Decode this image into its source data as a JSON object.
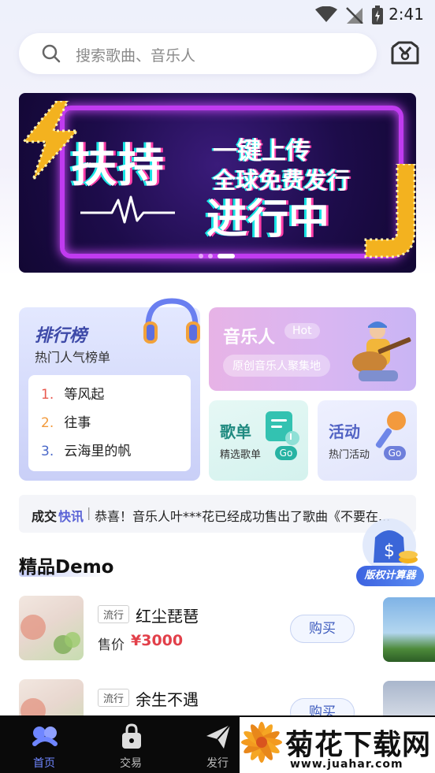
{
  "status_bar": {
    "time": "2:41"
  },
  "search": {
    "placeholder": "搜索歌曲、音乐人"
  },
  "banner": {
    "main_text": "扶持",
    "line1": "一键上传",
    "line2": "全球免费发行",
    "big_text": "进行中",
    "page_count": 3,
    "active_page": 3
  },
  "ranking": {
    "title": "排行榜",
    "subtitle": "热门人气榜单",
    "items": [
      {
        "rank": "1.",
        "name": "等风起",
        "color": "#e85a4f"
      },
      {
        "rank": "2.",
        "name": "往事",
        "color": "#f29a3c"
      },
      {
        "rank": "3.",
        "name": "云海里的帆",
        "color": "#4a68c9"
      }
    ]
  },
  "musician": {
    "title": "音乐人",
    "badge": "Hot",
    "subtitle": "原创音乐人聚集地"
  },
  "playlist": {
    "title": "歌单",
    "subtitle": "精选歌单",
    "go": "Go"
  },
  "activity": {
    "title": "活动",
    "subtitle": "热门活动",
    "go": "Go"
  },
  "ticker": {
    "label_a": "成交",
    "label_b": "快讯",
    "separator": "|",
    "text": "恭喜！音乐人叶***花已经成功售出了歌曲《不要在..."
  },
  "calculator": {
    "label": "版权计算器"
  },
  "demo_section": {
    "title": "精品Demo",
    "items": [
      {
        "tag": "流行",
        "name": "红尘琵琶",
        "price_label": "售价",
        "price": "¥3000",
        "buy": "购买"
      },
      {
        "tag": "流行",
        "name": "余生不遇",
        "price_label": "",
        "price": "",
        "buy": "购买"
      }
    ]
  },
  "bottom_nav": {
    "items": [
      {
        "label": "首页",
        "icon": "home-icon",
        "active": true
      },
      {
        "label": "交易",
        "icon": "lock-bag-icon",
        "active": false
      },
      {
        "label": "发行",
        "icon": "paper-plane-icon",
        "active": false
      }
    ]
  },
  "watermark": {
    "title": "菊花下载网",
    "url": "www.juahar.com"
  },
  "colors": {
    "accent": "#5a63d6",
    "price": "#e2404a",
    "nav_active": "#6f86ff"
  }
}
